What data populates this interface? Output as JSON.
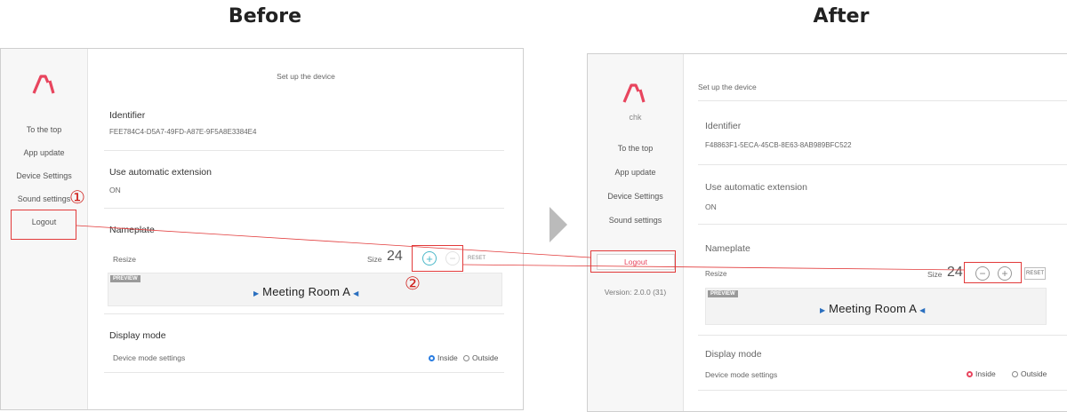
{
  "headings": {
    "before": "Before",
    "after": "After"
  },
  "colors": {
    "brand": "#e8455e",
    "radio_before": "#2a7de1",
    "radio_after": "#e8455e",
    "annotation": "#e23a3a",
    "plus_before": "#4bb8c9"
  },
  "before": {
    "page_title": "Set up the device",
    "nav": [
      "To the top",
      "App update",
      "Device Settings",
      "Sound settings",
      "Logout"
    ],
    "identifier": {
      "title": "Identifier",
      "value": "FEE784C4-D5A7-49FD-A87E-9F5A8E3384E4"
    },
    "auto_ext": {
      "title": "Use automatic extension",
      "value": "ON"
    },
    "nameplate": {
      "title": "Nameplate",
      "resize_label": "Resize",
      "size_label": "Size",
      "size_value": "24",
      "plus": "+",
      "minus": "−",
      "reset": "RESET",
      "preview_tag": "PREVIEW",
      "room": "Meeting Room A"
    },
    "display": {
      "title": "Display mode",
      "label": "Device mode settings",
      "inside": "Inside",
      "outside": "Outside",
      "selected": "inside"
    },
    "markers": {
      "one": "①",
      "two": "②"
    }
  },
  "after": {
    "page_title": "Set up the device",
    "user": "chk",
    "nav": [
      "To the top",
      "App update",
      "Device Settings",
      "Sound settings"
    ],
    "logout": "Logout",
    "version": "Version: 2.0.0 (31)",
    "identifier": {
      "title": "Identifier",
      "value": "F48863F1-5ECA-45CB-8E63-8AB989BFC522"
    },
    "auto_ext": {
      "title": "Use automatic extension",
      "value": "ON"
    },
    "nameplate": {
      "title": "Nameplate",
      "resize_label": "Resize",
      "size_label": "Size",
      "size_value": "24",
      "minus": "−",
      "plus": "+",
      "reset": "RESET",
      "preview_tag": "PREVIEW",
      "room": "Meeting Room A"
    },
    "display": {
      "title": "Display mode",
      "label": "Device mode settings",
      "inside": "Inside",
      "outside": "Outside",
      "selected": "inside"
    }
  }
}
